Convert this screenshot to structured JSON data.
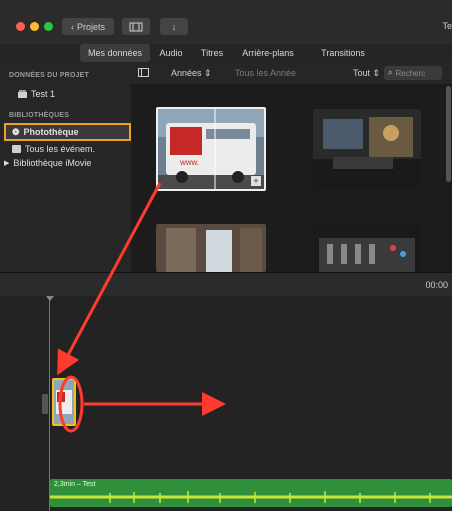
{
  "titlebar": {
    "back_label": "Projets",
    "window_title": "Te"
  },
  "tabs": [
    {
      "label": "Mes données"
    },
    {
      "label": "Audio"
    },
    {
      "label": "Titres"
    },
    {
      "label": "Arrière-plans"
    },
    {
      "label": "Transitions"
    }
  ],
  "sidebar": {
    "project_header": "DONNÉES DU PROJET",
    "project_item": "Test 1",
    "libraries_header": "BIBLIOTHÈQUES",
    "library_items": [
      "Photothèque",
      "Tous les événem.",
      "Bibliothèque iMovie"
    ]
  },
  "browser": {
    "years_label": "Années",
    "path_label": "Tous les Année",
    "filter_label": "Tout",
    "search_placeholder": "Recherc"
  },
  "timeline": {
    "timecode": "00:00",
    "audio_label": "2,3min – Test"
  },
  "colors": {
    "highlight": "#f0a020",
    "arrow": "#ff3b2f",
    "audio": "#2f8f3a"
  },
  "icons": [
    "back-chevron-icon",
    "film-icon",
    "download-icon",
    "project-icon",
    "photos-icon",
    "events-icon",
    "disclosure-icon",
    "sidebar-toggle-icon",
    "search-icon",
    "add-icon"
  ]
}
